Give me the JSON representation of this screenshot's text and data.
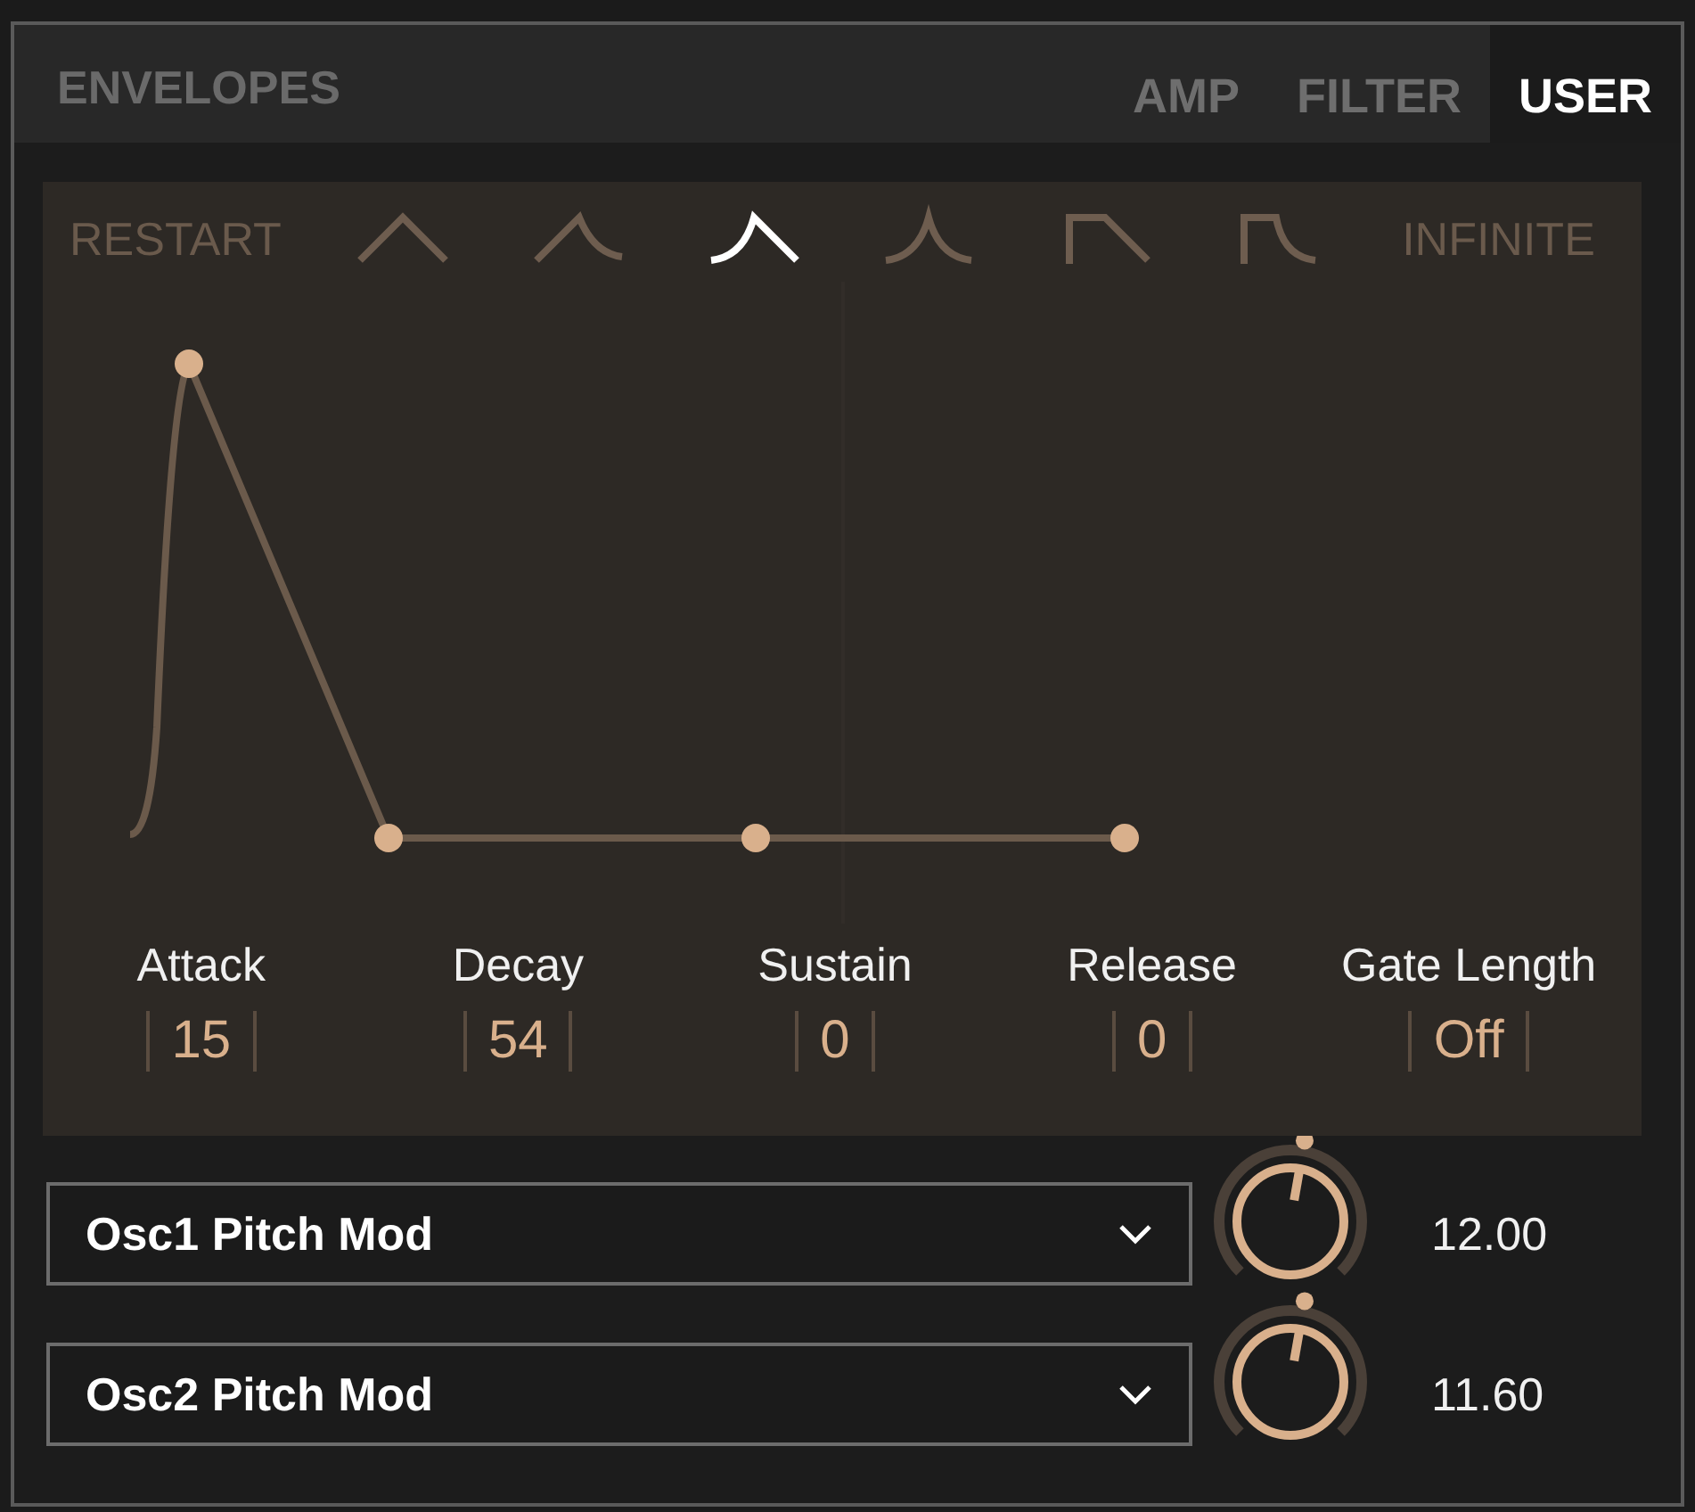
{
  "header": {
    "title": "ENVELOPES"
  },
  "tabs": [
    {
      "label": "AMP",
      "selected": false
    },
    {
      "label": "FILTER",
      "selected": false
    },
    {
      "label": "USER",
      "selected": true
    }
  ],
  "envelope": {
    "restart_label": "RESTART",
    "infinite_label": "INFINITE",
    "shapes": [
      {
        "kind": "linear",
        "selected": false
      },
      {
        "kind": "concave-release",
        "selected": false
      },
      {
        "kind": "concave-attack",
        "selected": true
      },
      {
        "kind": "concave-both",
        "selected": false
      },
      {
        "kind": "hold",
        "selected": false
      },
      {
        "kind": "hold-curve",
        "selected": false
      }
    ],
    "params": [
      {
        "label": "Attack",
        "value": "15"
      },
      {
        "label": "Decay",
        "value": "54"
      },
      {
        "label": "Sustain",
        "value": "0"
      },
      {
        "label": "Release",
        "value": "0"
      },
      {
        "label": "Gate Length",
        "value": "Off"
      }
    ]
  },
  "mods": [
    {
      "target": "Osc1 Pitch Mod",
      "reading": "12.00"
    },
    {
      "target": "Osc2 Pitch Mod",
      "reading": "11.60"
    }
  ]
}
